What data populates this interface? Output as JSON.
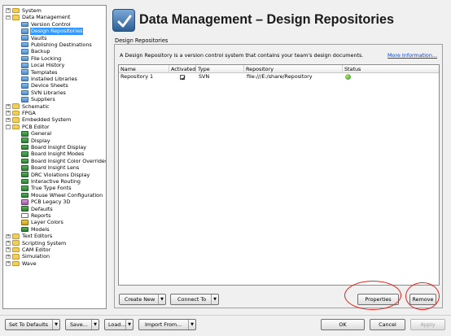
{
  "tree": [
    {
      "label": "System",
      "depth": 0,
      "expander": "+",
      "icon": "folder-icon"
    },
    {
      "label": "Data Management",
      "depth": 0,
      "expander": "−",
      "icon": "folder-icon"
    },
    {
      "label": "Version Control",
      "depth": 1,
      "expander": "",
      "icon": "page-icon"
    },
    {
      "label": "Design Repositories",
      "depth": 1,
      "expander": "",
      "icon": "page-icon",
      "selected": true
    },
    {
      "label": "Vaults",
      "depth": 1,
      "expander": "",
      "icon": "page-icon"
    },
    {
      "label": "Publishing Destinations",
      "depth": 1,
      "expander": "",
      "icon": "page-icon"
    },
    {
      "label": "Backup",
      "depth": 1,
      "expander": "",
      "icon": "page-icon"
    },
    {
      "label": "File Locking",
      "depth": 1,
      "expander": "",
      "icon": "page-icon"
    },
    {
      "label": "Local History",
      "depth": 1,
      "expander": "",
      "icon": "page-icon"
    },
    {
      "label": "Templates",
      "depth": 1,
      "expander": "",
      "icon": "page-icon"
    },
    {
      "label": "Installed Libraries",
      "depth": 1,
      "expander": "",
      "icon": "page-icon"
    },
    {
      "label": "Device Sheets",
      "depth": 1,
      "expander": "",
      "icon": "page-icon"
    },
    {
      "label": "SVN Libraries",
      "depth": 1,
      "expander": "",
      "icon": "page-icon"
    },
    {
      "label": "Suppliers",
      "depth": 1,
      "expander": "",
      "icon": "page-icon"
    },
    {
      "label": "Schematic",
      "depth": 0,
      "expander": "+",
      "icon": "folder-icon"
    },
    {
      "label": "FPGA",
      "depth": 0,
      "expander": "+",
      "icon": "folder-icon"
    },
    {
      "label": "Embedded System",
      "depth": 0,
      "expander": "+",
      "icon": "folder-icon"
    },
    {
      "label": "PCB Editor",
      "depth": 0,
      "expander": "−",
      "icon": "folder-icon"
    },
    {
      "label": "General",
      "depth": 1,
      "expander": "",
      "icon": "green-icon"
    },
    {
      "label": "Display",
      "depth": 1,
      "expander": "",
      "icon": "green-icon"
    },
    {
      "label": "Board Insight Display",
      "depth": 1,
      "expander": "",
      "icon": "green-icon"
    },
    {
      "label": "Board Insight Modes",
      "depth": 1,
      "expander": "",
      "icon": "green-icon"
    },
    {
      "label": "Board Insight Color Overrides",
      "depth": 1,
      "expander": "",
      "icon": "green-icon"
    },
    {
      "label": "Board Insight Lens",
      "depth": 1,
      "expander": "",
      "icon": "green-icon"
    },
    {
      "label": "DRC Violations Display",
      "depth": 1,
      "expander": "",
      "icon": "green-icon"
    },
    {
      "label": "Interactive Routing",
      "depth": 1,
      "expander": "",
      "icon": "green-icon"
    },
    {
      "label": "True Type Fonts",
      "depth": 1,
      "expander": "",
      "icon": "green-icon"
    },
    {
      "label": "Mouse Wheel Configuration",
      "depth": 1,
      "expander": "",
      "icon": "mouse-icon"
    },
    {
      "label": "PCB Legacy 3D",
      "depth": 1,
      "expander": "",
      "icon": "lib-icon"
    },
    {
      "label": "Defaults",
      "depth": 1,
      "expander": "",
      "icon": "green-icon"
    },
    {
      "label": "Reports",
      "depth": 1,
      "expander": "",
      "icon": "doc-icon"
    },
    {
      "label": "Layer Colors",
      "depth": 1,
      "expander": "",
      "icon": "layer-icon"
    },
    {
      "label": "Models",
      "depth": 1,
      "expander": "",
      "icon": "green-icon"
    },
    {
      "label": "Text Editors",
      "depth": 0,
      "expander": "+",
      "icon": "folder-icon"
    },
    {
      "label": "Scripting System",
      "depth": 0,
      "expander": "+",
      "icon": "folder-icon"
    },
    {
      "label": "CAM Editor",
      "depth": 0,
      "expander": "+",
      "icon": "folder-icon"
    },
    {
      "label": "Simulation",
      "depth": 0,
      "expander": "+",
      "icon": "folder-icon"
    },
    {
      "label": "Wave",
      "depth": 0,
      "expander": "+",
      "icon": "folder-icon"
    }
  ],
  "header": {
    "title": "Data Management – Design Repositories"
  },
  "section": {
    "label": "Design Repositories",
    "description": "A Design Repository is a version control system that contains your team's design documents.",
    "more_link": "More Information..."
  },
  "grid": {
    "columns": [
      "Name",
      "Activated",
      "Type",
      "Repository",
      "Status"
    ],
    "rows": [
      {
        "name": "Repository 1",
        "activated": true,
        "type": "SVN",
        "repository": "file:///E:/share/Repository",
        "status": "ok"
      }
    ]
  },
  "panel_buttons": {
    "create_new": "Create New",
    "connect_to": "Connect To",
    "properties": "Properties",
    "remove": "Remove"
  },
  "footer_buttons": {
    "set_to_defaults": "Set To Defaults",
    "save": "Save...",
    "load": "Load...",
    "import_from": "Import From...",
    "ok": "OK",
    "cancel": "Cancel",
    "apply": "Apply"
  },
  "colors": {
    "selection": "#3399ff",
    "link": "#0645d1",
    "annotation": "#e0231b"
  }
}
